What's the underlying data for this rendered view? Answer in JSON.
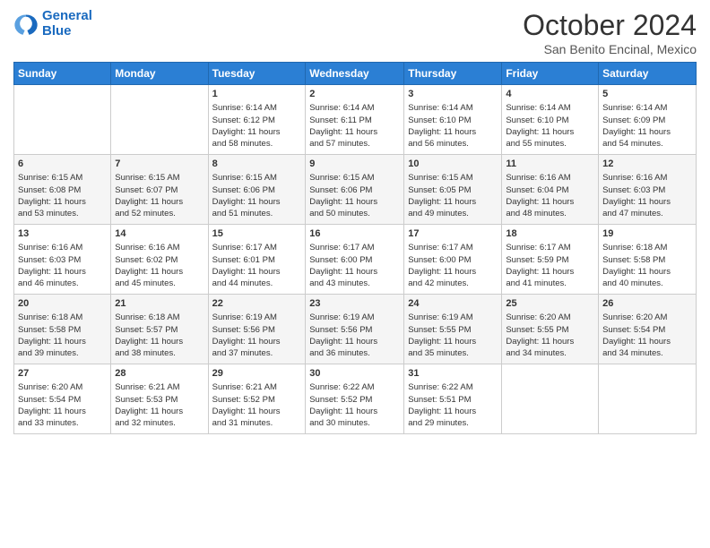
{
  "logo": {
    "line1": "General",
    "line2": "Blue"
  },
  "title": "October 2024",
  "location": "San Benito Encinal, Mexico",
  "weekdays": [
    "Sunday",
    "Monday",
    "Tuesday",
    "Wednesday",
    "Thursday",
    "Friday",
    "Saturday"
  ],
  "weeks": [
    [
      {
        "day": "",
        "info": ""
      },
      {
        "day": "",
        "info": ""
      },
      {
        "day": "1",
        "info": "Sunrise: 6:14 AM\nSunset: 6:12 PM\nDaylight: 11 hours\nand 58 minutes."
      },
      {
        "day": "2",
        "info": "Sunrise: 6:14 AM\nSunset: 6:11 PM\nDaylight: 11 hours\nand 57 minutes."
      },
      {
        "day": "3",
        "info": "Sunrise: 6:14 AM\nSunset: 6:10 PM\nDaylight: 11 hours\nand 56 minutes."
      },
      {
        "day": "4",
        "info": "Sunrise: 6:14 AM\nSunset: 6:10 PM\nDaylight: 11 hours\nand 55 minutes."
      },
      {
        "day": "5",
        "info": "Sunrise: 6:14 AM\nSunset: 6:09 PM\nDaylight: 11 hours\nand 54 minutes."
      }
    ],
    [
      {
        "day": "6",
        "info": "Sunrise: 6:15 AM\nSunset: 6:08 PM\nDaylight: 11 hours\nand 53 minutes."
      },
      {
        "day": "7",
        "info": "Sunrise: 6:15 AM\nSunset: 6:07 PM\nDaylight: 11 hours\nand 52 minutes."
      },
      {
        "day": "8",
        "info": "Sunrise: 6:15 AM\nSunset: 6:06 PM\nDaylight: 11 hours\nand 51 minutes."
      },
      {
        "day": "9",
        "info": "Sunrise: 6:15 AM\nSunset: 6:06 PM\nDaylight: 11 hours\nand 50 minutes."
      },
      {
        "day": "10",
        "info": "Sunrise: 6:15 AM\nSunset: 6:05 PM\nDaylight: 11 hours\nand 49 minutes."
      },
      {
        "day": "11",
        "info": "Sunrise: 6:16 AM\nSunset: 6:04 PM\nDaylight: 11 hours\nand 48 minutes."
      },
      {
        "day": "12",
        "info": "Sunrise: 6:16 AM\nSunset: 6:03 PM\nDaylight: 11 hours\nand 47 minutes."
      }
    ],
    [
      {
        "day": "13",
        "info": "Sunrise: 6:16 AM\nSunset: 6:03 PM\nDaylight: 11 hours\nand 46 minutes."
      },
      {
        "day": "14",
        "info": "Sunrise: 6:16 AM\nSunset: 6:02 PM\nDaylight: 11 hours\nand 45 minutes."
      },
      {
        "day": "15",
        "info": "Sunrise: 6:17 AM\nSunset: 6:01 PM\nDaylight: 11 hours\nand 44 minutes."
      },
      {
        "day": "16",
        "info": "Sunrise: 6:17 AM\nSunset: 6:00 PM\nDaylight: 11 hours\nand 43 minutes."
      },
      {
        "day": "17",
        "info": "Sunrise: 6:17 AM\nSunset: 6:00 PM\nDaylight: 11 hours\nand 42 minutes."
      },
      {
        "day": "18",
        "info": "Sunrise: 6:17 AM\nSunset: 5:59 PM\nDaylight: 11 hours\nand 41 minutes."
      },
      {
        "day": "19",
        "info": "Sunrise: 6:18 AM\nSunset: 5:58 PM\nDaylight: 11 hours\nand 40 minutes."
      }
    ],
    [
      {
        "day": "20",
        "info": "Sunrise: 6:18 AM\nSunset: 5:58 PM\nDaylight: 11 hours\nand 39 minutes."
      },
      {
        "day": "21",
        "info": "Sunrise: 6:18 AM\nSunset: 5:57 PM\nDaylight: 11 hours\nand 38 minutes."
      },
      {
        "day": "22",
        "info": "Sunrise: 6:19 AM\nSunset: 5:56 PM\nDaylight: 11 hours\nand 37 minutes."
      },
      {
        "day": "23",
        "info": "Sunrise: 6:19 AM\nSunset: 5:56 PM\nDaylight: 11 hours\nand 36 minutes."
      },
      {
        "day": "24",
        "info": "Sunrise: 6:19 AM\nSunset: 5:55 PM\nDaylight: 11 hours\nand 35 minutes."
      },
      {
        "day": "25",
        "info": "Sunrise: 6:20 AM\nSunset: 5:55 PM\nDaylight: 11 hours\nand 34 minutes."
      },
      {
        "day": "26",
        "info": "Sunrise: 6:20 AM\nSunset: 5:54 PM\nDaylight: 11 hours\nand 34 minutes."
      }
    ],
    [
      {
        "day": "27",
        "info": "Sunrise: 6:20 AM\nSunset: 5:54 PM\nDaylight: 11 hours\nand 33 minutes."
      },
      {
        "day": "28",
        "info": "Sunrise: 6:21 AM\nSunset: 5:53 PM\nDaylight: 11 hours\nand 32 minutes."
      },
      {
        "day": "29",
        "info": "Sunrise: 6:21 AM\nSunset: 5:52 PM\nDaylight: 11 hours\nand 31 minutes."
      },
      {
        "day": "30",
        "info": "Sunrise: 6:22 AM\nSunset: 5:52 PM\nDaylight: 11 hours\nand 30 minutes."
      },
      {
        "day": "31",
        "info": "Sunrise: 6:22 AM\nSunset: 5:51 PM\nDaylight: 11 hours\nand 29 minutes."
      },
      {
        "day": "",
        "info": ""
      },
      {
        "day": "",
        "info": ""
      }
    ]
  ]
}
